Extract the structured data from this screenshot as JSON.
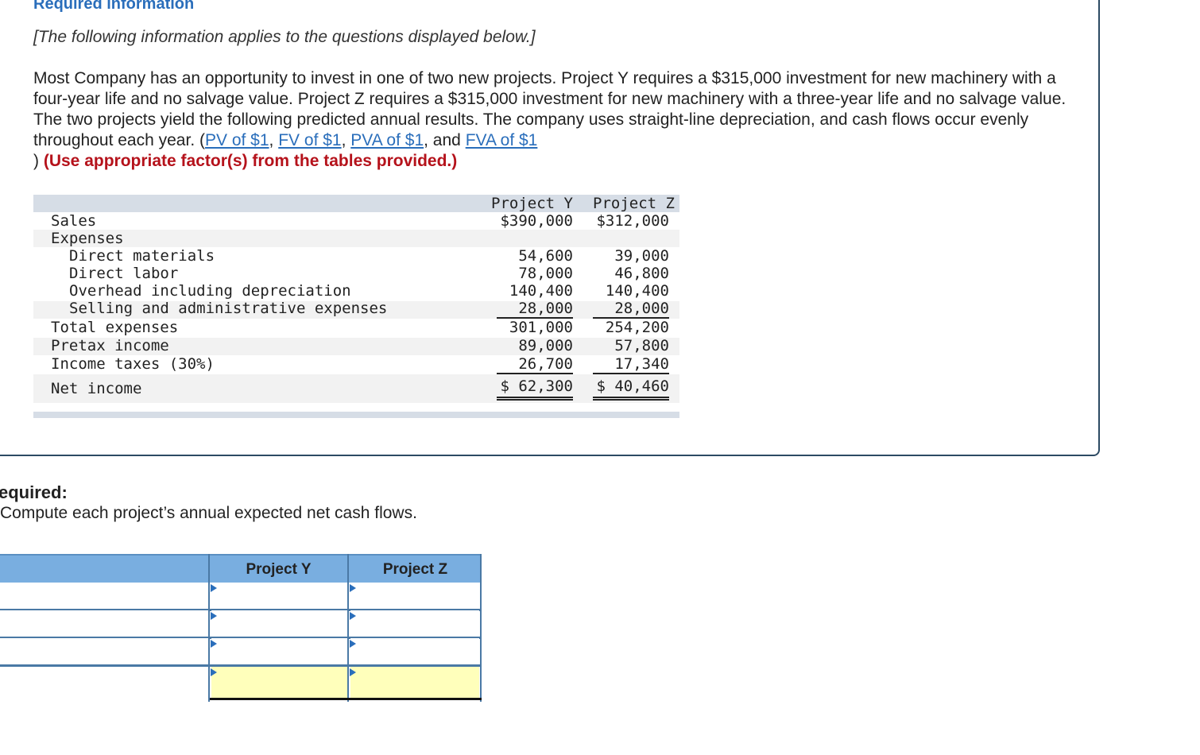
{
  "header": {
    "title": "Required information",
    "intro": "[The following information applies to the questions displayed below.]"
  },
  "problem": {
    "text": "Most Company has an opportunity to invest in one of two new projects. Project Y requires a $315,000 investment for new machinery with a four-year life and no salvage value. Project Z requires a $315,000 investment for new machinery with a three-year life and no salvage value. The two projects yield the following predicted annual results. The company uses straight-line depreciation, and cash flows occur evenly throughout each year. (",
    "links": [
      "PV of $1",
      "FV of $1",
      "PVA of $1",
      "FVA of $1"
    ],
    "sep1": ", ",
    "sep2": ", ",
    "sep3": ", and ",
    "close": ")",
    "instruction": "(Use appropriate factor(s) from the tables provided.)"
  },
  "statement": {
    "col_y": "Project Y",
    "col_z": "Project Z",
    "rows": [
      {
        "label": "Sales",
        "y": "$390,000",
        "z": "$312,000"
      },
      {
        "label": "Expenses",
        "y": "",
        "z": ""
      },
      {
        "label": "Direct materials",
        "y": "54,600",
        "z": "39,000"
      },
      {
        "label": "Direct labor",
        "y": "78,000",
        "z": "46,800"
      },
      {
        "label": "Overhead including depreciation",
        "y": "140,400",
        "z": "140,400"
      },
      {
        "label": "Selling and administrative expenses",
        "y": "28,000",
        "z": "28,000"
      },
      {
        "label": "Total expenses",
        "y": "301,000",
        "z": "254,200"
      },
      {
        "label": "Pretax income",
        "y": "89,000",
        "z": "57,800"
      },
      {
        "label": "Income taxes (30%)",
        "y": "26,700",
        "z": "17,340"
      },
      {
        "label": "Net income",
        "y": "$ 62,300",
        "z": "$ 40,460"
      }
    ]
  },
  "required": {
    "heading": "equired:",
    "text": "Compute each project’s annual expected net cash flows."
  },
  "answer_grid": {
    "col_y": "Project Y",
    "col_z": "Project Z",
    "rows": [
      {
        "y": "",
        "z": ""
      },
      {
        "y": "",
        "z": ""
      },
      {
        "y": "",
        "z": ""
      },
      {
        "y": "",
        "z": ""
      }
    ],
    "total_row_color": "#ffffbb",
    "header_color": "#79aee0"
  }
}
